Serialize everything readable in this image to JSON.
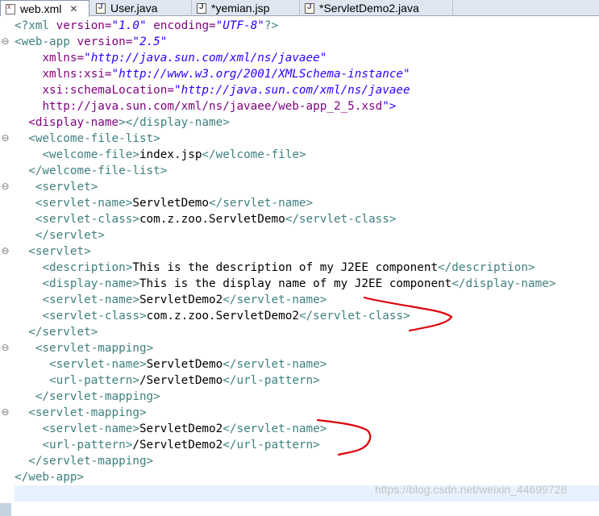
{
  "tabs": [
    {
      "label": "web.xml",
      "icon": "xml-file-icon",
      "active": true,
      "closable": true
    },
    {
      "label": "User.java",
      "icon": "java-file-icon",
      "active": false
    },
    {
      "label": "*yemian.jsp",
      "icon": "jsp-file-icon",
      "active": false
    },
    {
      "label": "*ServletDemo2.java",
      "icon": "java-file-icon",
      "active": false
    }
  ],
  "close_glyph": "✕",
  "editor": {
    "lines": [
      "<?xml version=\"1.0\" encoding=\"UTF-8\"?>",
      "<web-app version=\"2.5\"",
      "    xmlns=\"http://java.sun.com/xml/ns/javaee\"",
      "    xmlns:xsi=\"http://www.w3.org/2001/XMLSchema-instance\"",
      "    xsi:schemaLocation=\"http://java.sun.com/xml/ns/javaee",
      "    http://java.sun.com/xml/ns/javaee/web-app_2_5.xsd\">",
      "  <display-name></display-name>",
      "  <welcome-file-list>",
      "    <welcome-file>index.jsp</welcome-file>",
      "  </welcome-file-list>",
      "   <servlet>",
      "   <servlet-name>ServletDemo</servlet-name>",
      "   <servlet-class>com.z.zoo.ServletDemo</servlet-class>",
      "   </servlet>",
      "  <servlet>",
      "    <description>This is the description of my J2EE component</description>",
      "    <display-name>This is the display name of my J2EE component</display-name>",
      "    <servlet-name>ServletDemo2</servlet-name>",
      "    <servlet-class>com.z.zoo.ServletDemo2</servlet-class>",
      "  </servlet>",
      "   <servlet-mapping>",
      "     <servlet-name>ServletDemo</servlet-name>",
      "     <url-pattern>/ServletDemo</url-pattern>",
      "   </servlet-mapping>",
      "  <servlet-mapping>",
      "    <servlet-name>ServletDemo2</servlet-name>",
      "    <url-pattern>/ServletDemo2</url-pattern>",
      "  </servlet-mapping>",
      "</web-app>",
      ""
    ],
    "current_line": 29,
    "fold_lines": [
      1,
      7,
      10,
      14,
      20,
      24
    ]
  },
  "fold_glyph": "⊖",
  "colors": {
    "tag": "#3f7f7f",
    "attribute": "#7f007f",
    "attribute_value": "#2a00ff",
    "text": "#000000",
    "annotation": "#e0000a",
    "current_line": "#e8f2fe"
  },
  "watermark": "https://blog.csdn.net/weixin_44699728"
}
